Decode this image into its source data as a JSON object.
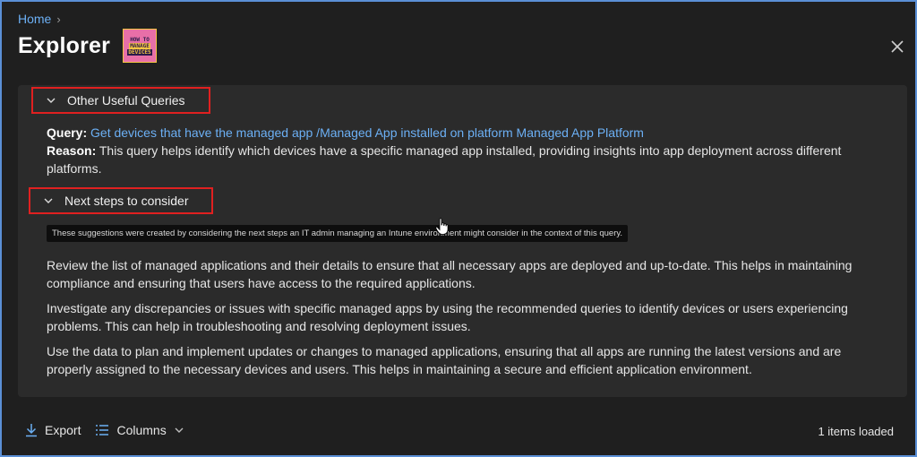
{
  "breadcrumb": {
    "home": "Home"
  },
  "header": {
    "title": "Explorer",
    "logo": {
      "line1": "HOW TO",
      "line2": "MANAGE",
      "line3": "DEVICES"
    }
  },
  "sections": {
    "other_queries": {
      "label": "Other Useful Queries",
      "query_label": "Query:",
      "query_text": "Get devices that have the managed app /Managed App installed on platform Managed App Platform",
      "reason_label": "Reason:",
      "reason_text": "This query helps identify which devices have a specific managed app installed, providing insights into app deployment across different platforms."
    },
    "next_steps": {
      "label": "Next steps to consider",
      "tooltip": "These suggestions were created by considering the next steps an IT admin managing an Intune environment might consider in the context of this query.",
      "paragraphs": [
        "Review the list of managed applications and their details to ensure that all necessary apps are deployed and up-to-date. This helps in maintaining compliance and ensuring that users have access to the required applications.",
        "Investigate any discrepancies or issues with specific managed apps by using the recommended queries to identify devices or users experiencing problems. This can help in troubleshooting and resolving deployment issues.",
        "Use the data to plan and implement updates or changes to managed applications, ensuring that all apps are running the latest versions and are properly assigned to the necessary devices and users. This helps in maintaining a secure and efficient application environment."
      ]
    }
  },
  "footer": {
    "export_label": "Export",
    "columns_label": "Columns",
    "items_loaded": "1 items loaded"
  },
  "colors": {
    "accent": "#6cb0f5",
    "highlight_box": "#e02020",
    "background": "#1f1f1f",
    "panel": "#2b2b2b"
  }
}
